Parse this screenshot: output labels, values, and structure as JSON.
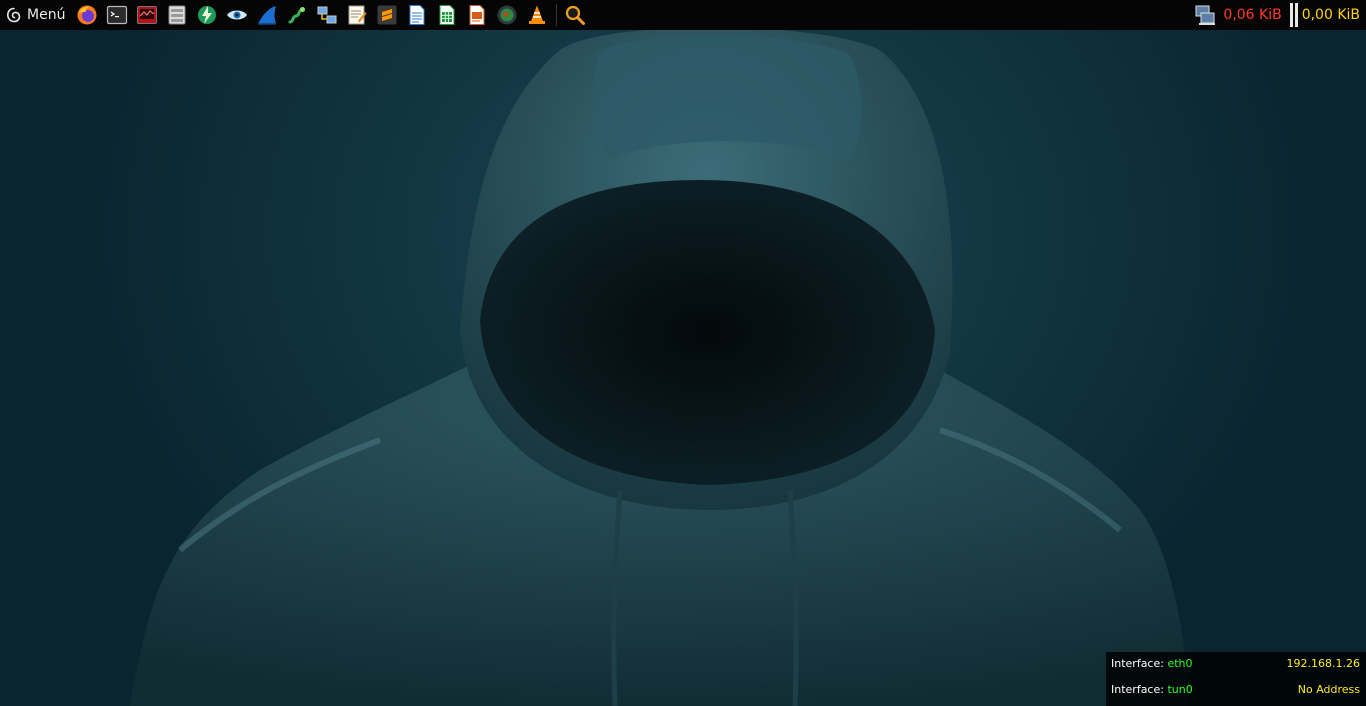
{
  "panel": {
    "menu_label": "Menú",
    "launchers": [
      {
        "icon": "firefox-icon"
      },
      {
        "icon": "terminal-icon"
      },
      {
        "icon": "system-monitor-icon"
      },
      {
        "icon": "file-manager-icon"
      },
      {
        "icon": "lightning-tool-icon"
      },
      {
        "icon": "eye-icon"
      },
      {
        "icon": "wireshark-fin-icon"
      },
      {
        "icon": "snake-tool-icon"
      },
      {
        "icon": "network-tool-icon"
      },
      {
        "icon": "text-editor-icon"
      },
      {
        "icon": "sublime-text-icon"
      },
      {
        "icon": "writer-document-icon"
      },
      {
        "icon": "calc-spreadsheet-icon"
      },
      {
        "icon": "impress-presentation-icon"
      },
      {
        "icon": "globe-browser-icon"
      },
      {
        "icon": "vlc-cone-icon"
      },
      {
        "icon": "magnifier-search-icon"
      }
    ],
    "net_down": "0,06  KiB",
    "net_up": "0,00  KiB"
  },
  "conky": {
    "rows": [
      {
        "label": "Interface:",
        "iface": "eth0",
        "addr": "192.168.1.26"
      },
      {
        "label": "Interface:",
        "iface": "tun0",
        "addr": "No Address"
      }
    ]
  },
  "colors": {
    "panel_bg": "#050505",
    "down_rate": "#ff3b2a",
    "up_rate": "#ffd21c",
    "iface_green": "#2cff2c",
    "addr_yellow": "#ffea2a"
  }
}
